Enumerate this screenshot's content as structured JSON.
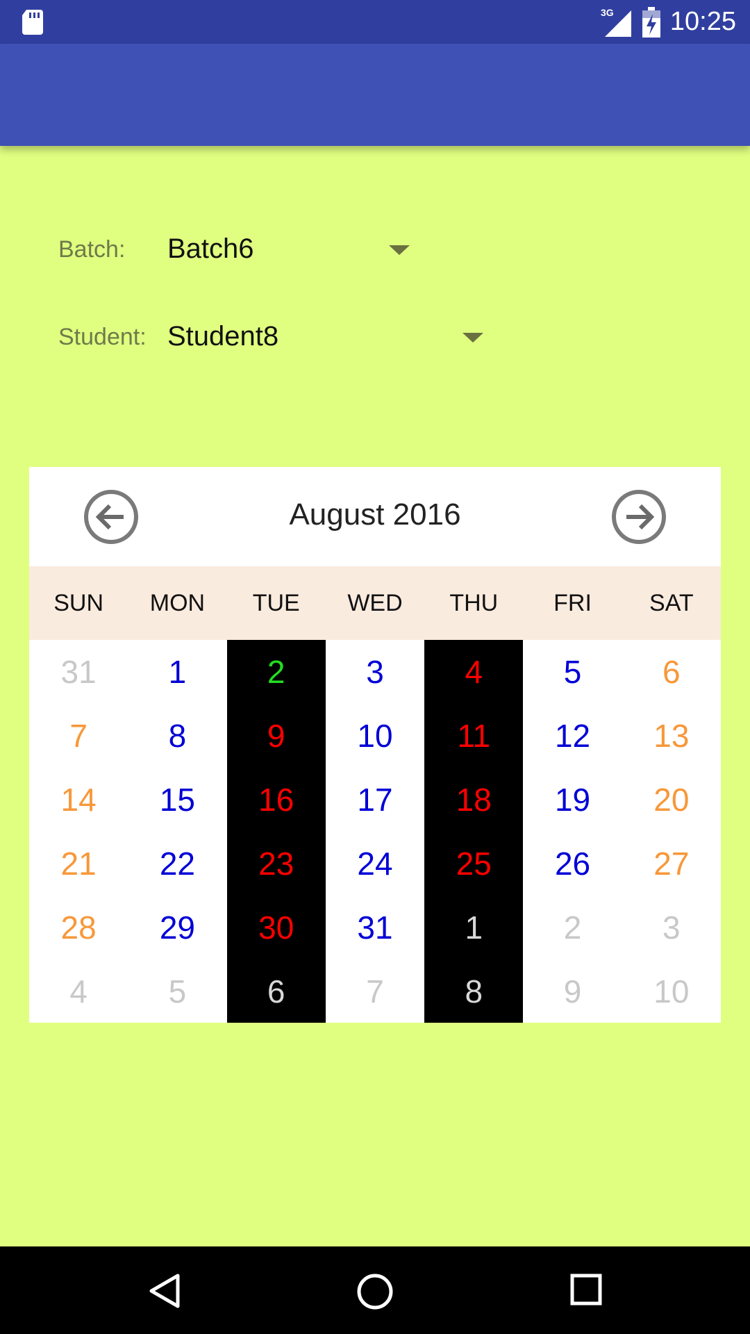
{
  "status_bar": {
    "time": "10:25",
    "network": "3G",
    "icons": [
      "sd-card-icon",
      "signal-icon",
      "battery-icon"
    ]
  },
  "form": {
    "batch_label": "Batch:",
    "batch_value": "Batch6",
    "student_label": "Student:",
    "student_value": "Student8"
  },
  "calendar": {
    "title": "August 2016",
    "prev_icon": "arrow-left-circle-icon",
    "next_icon": "arrow-right-circle-icon",
    "weekdays": [
      "SUN",
      "MON",
      "TUE",
      "WED",
      "THU",
      "FRI",
      "SAT"
    ],
    "highlight_columns": [
      2,
      4
    ],
    "colors": {
      "muted": "#c8c8c8",
      "weekend": "#f7983a",
      "weekday": "#0000d6",
      "absent": "#ff0000",
      "present": "#22dd22",
      "other_on_black": "#d8d8d8",
      "highlight_bg": "#000000"
    },
    "weeks": [
      [
        {
          "d": "31",
          "s": "muted"
        },
        {
          "d": "1",
          "s": "weekday"
        },
        {
          "d": "2",
          "s": "present"
        },
        {
          "d": "3",
          "s": "weekday"
        },
        {
          "d": "4",
          "s": "absent"
        },
        {
          "d": "5",
          "s": "weekday"
        },
        {
          "d": "6",
          "s": "weekend"
        }
      ],
      [
        {
          "d": "7",
          "s": "weekend"
        },
        {
          "d": "8",
          "s": "weekday"
        },
        {
          "d": "9",
          "s": "absent"
        },
        {
          "d": "10",
          "s": "weekday"
        },
        {
          "d": "11",
          "s": "absent"
        },
        {
          "d": "12",
          "s": "weekday"
        },
        {
          "d": "13",
          "s": "weekend"
        }
      ],
      [
        {
          "d": "14",
          "s": "weekend"
        },
        {
          "d": "15",
          "s": "weekday"
        },
        {
          "d": "16",
          "s": "absent"
        },
        {
          "d": "17",
          "s": "weekday"
        },
        {
          "d": "18",
          "s": "absent"
        },
        {
          "d": "19",
          "s": "weekday"
        },
        {
          "d": "20",
          "s": "weekend"
        }
      ],
      [
        {
          "d": "21",
          "s": "weekend"
        },
        {
          "d": "22",
          "s": "weekday"
        },
        {
          "d": "23",
          "s": "absent"
        },
        {
          "d": "24",
          "s": "weekday"
        },
        {
          "d": "25",
          "s": "absent"
        },
        {
          "d": "26",
          "s": "weekday"
        },
        {
          "d": "27",
          "s": "weekend"
        }
      ],
      [
        {
          "d": "28",
          "s": "weekend"
        },
        {
          "d": "29",
          "s": "weekday"
        },
        {
          "d": "30",
          "s": "absent"
        },
        {
          "d": "31",
          "s": "weekday"
        },
        {
          "d": "1",
          "s": "other_on_black"
        },
        {
          "d": "2",
          "s": "muted"
        },
        {
          "d": "3",
          "s": "muted"
        }
      ],
      [
        {
          "d": "4",
          "s": "muted"
        },
        {
          "d": "5",
          "s": "muted"
        },
        {
          "d": "6",
          "s": "other_on_black"
        },
        {
          "d": "7",
          "s": "muted"
        },
        {
          "d": "8",
          "s": "other_on_black"
        },
        {
          "d": "9",
          "s": "muted"
        },
        {
          "d": "10",
          "s": "muted"
        }
      ]
    ]
  },
  "nav_bar": {
    "icons": [
      "back-triangle-icon",
      "home-circle-icon",
      "recents-square-icon"
    ]
  }
}
